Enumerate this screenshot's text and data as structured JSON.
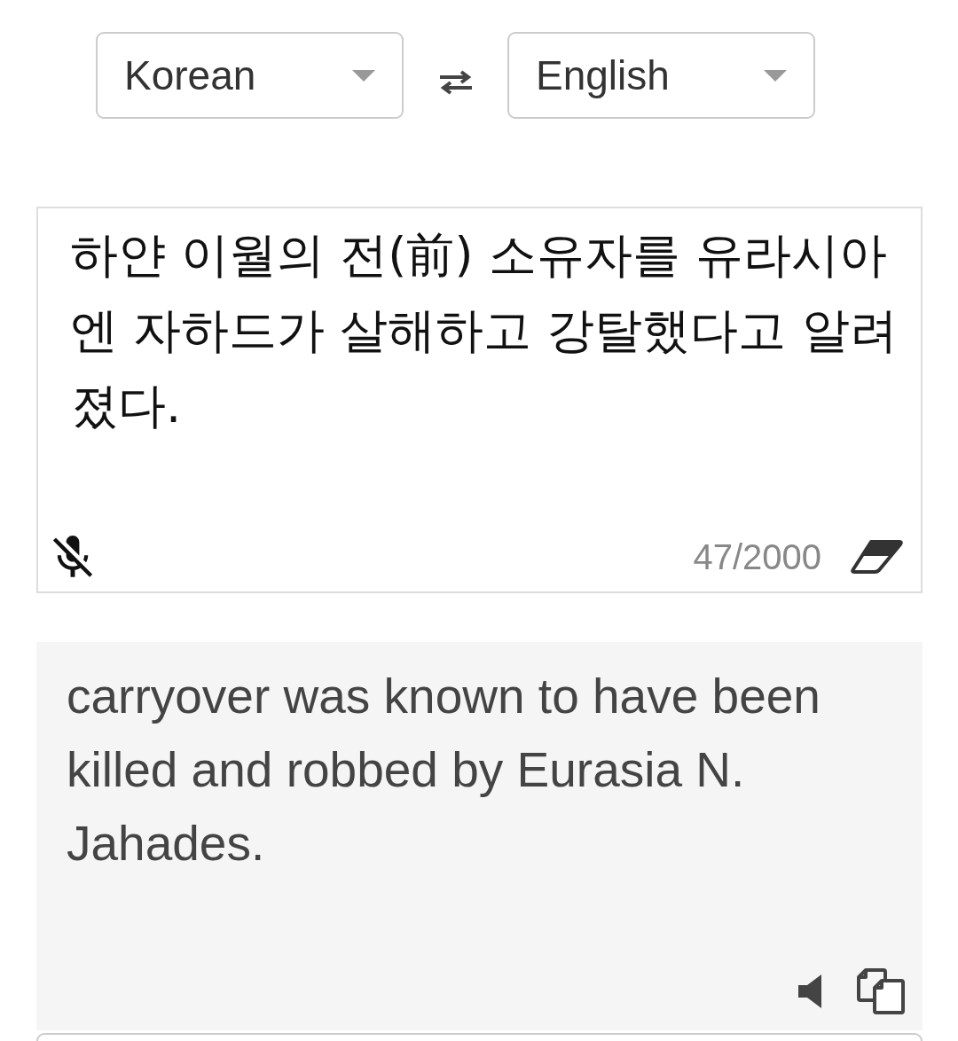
{
  "language_bar": {
    "source_language": {
      "label": "Korean"
    },
    "target_language": {
      "label": "English"
    }
  },
  "source": {
    "text": "하얀 이월의 전(前) 소유자를 유라시아엔 자하드가 살해하고 강탈했다고 알려졌다.",
    "char_count": "47/2000"
  },
  "translation": {
    "text": "carryover was known to have been killed and robbed by Eurasia N. Jahades."
  }
}
